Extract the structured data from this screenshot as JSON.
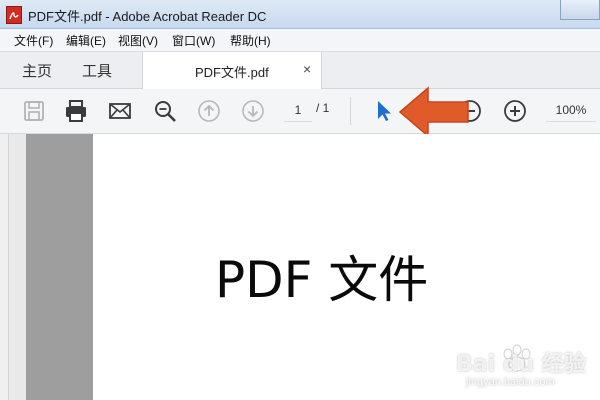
{
  "window": {
    "title": "PDF文件.pdf - Adobe Acrobat Reader DC"
  },
  "menu": {
    "items": [
      "文件(F)",
      "编辑(E)",
      "视图(V)",
      "窗口(W)",
      "帮助(H)"
    ]
  },
  "tabs": {
    "home": "主页",
    "tools": "工具",
    "document": "PDF文件.pdf",
    "close": "×"
  },
  "toolbar": {
    "page_current": "1",
    "page_total": "/ 1",
    "zoom": "100%"
  },
  "document": {
    "content": "PDF 文件"
  },
  "watermark": {
    "brand": "Bai du 经验",
    "url": "jingyan.baidu.com"
  },
  "colors": {
    "annotation_arrow": "#e05a2a",
    "select_tool": "#1f6fd1",
    "acrobat_red": "#d42a20"
  },
  "icons": [
    "save-icon",
    "print-icon",
    "email-icon",
    "zoom-search-icon",
    "page-up-icon",
    "page-down-icon",
    "select-cursor-icon",
    "hand-icon",
    "zoom-out-icon",
    "zoom-in-icon"
  ]
}
